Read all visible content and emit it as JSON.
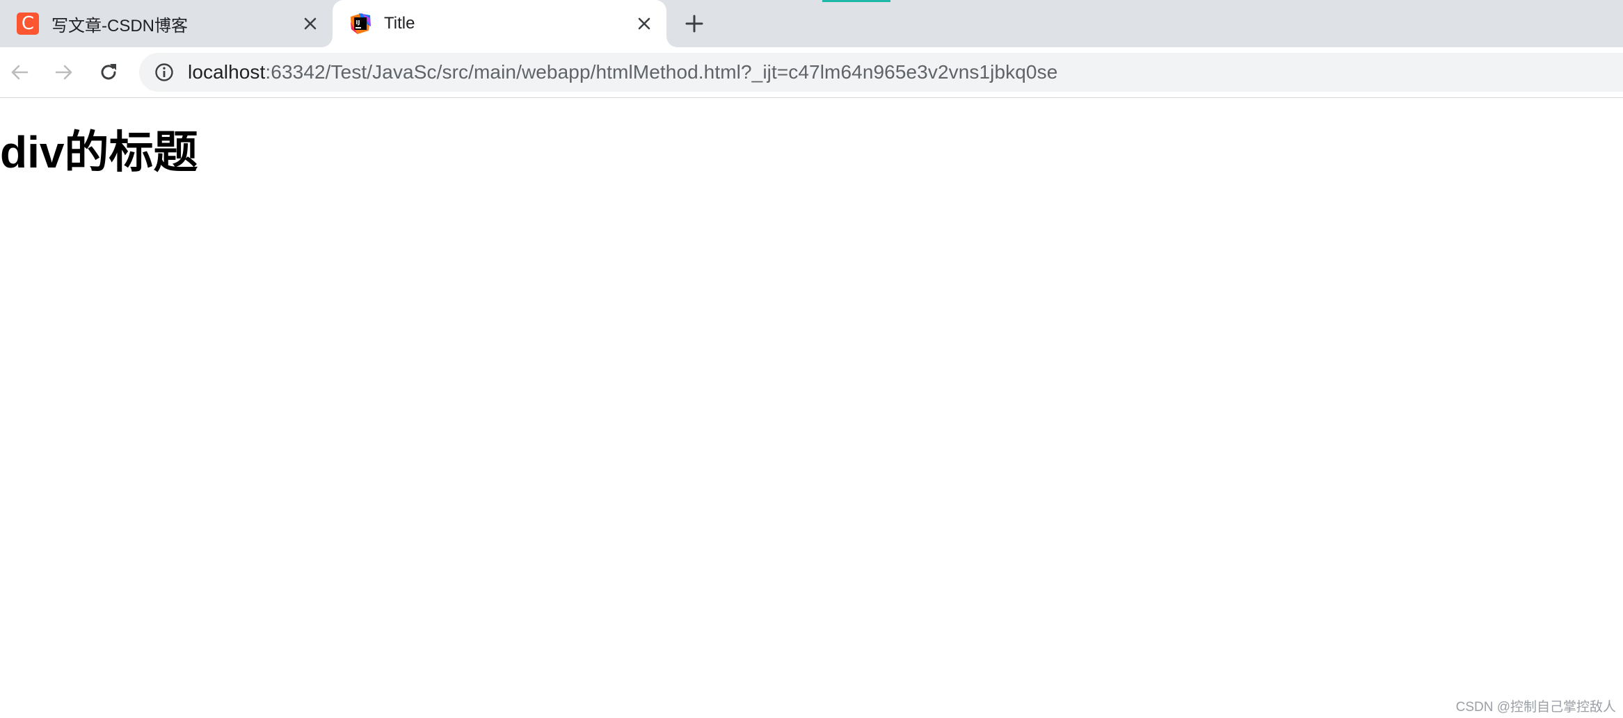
{
  "tabs": [
    {
      "title": "写文章-CSDN博客",
      "favicon": "csdn-logo-icon",
      "favicon_letter": "C",
      "active": false
    },
    {
      "title": "Title",
      "favicon": "intellij-idea-logo-icon",
      "active": true
    }
  ],
  "toolbar": {
    "back_icon": "arrow-left-icon",
    "forward_icon": "arrow-right-icon",
    "reload_icon": "reload-icon"
  },
  "address_bar": {
    "site_info_icon": "info-icon",
    "url_host": "localhost",
    "url_rest": ":63342/Test/JavaSc/src/main/webapp/htmlMethod.html?_ijt=c47lm64n965e3v2vns1jbkq0se"
  },
  "page": {
    "heading": "div的标题"
  },
  "watermark": "CSDN @控制自己掌控敌人",
  "colors": {
    "tabstrip": "#dee1e6",
    "omnibox": "#f1f3f4",
    "csdn_brand": "#fc5531",
    "loading_indicator": "#1fb8a8"
  }
}
